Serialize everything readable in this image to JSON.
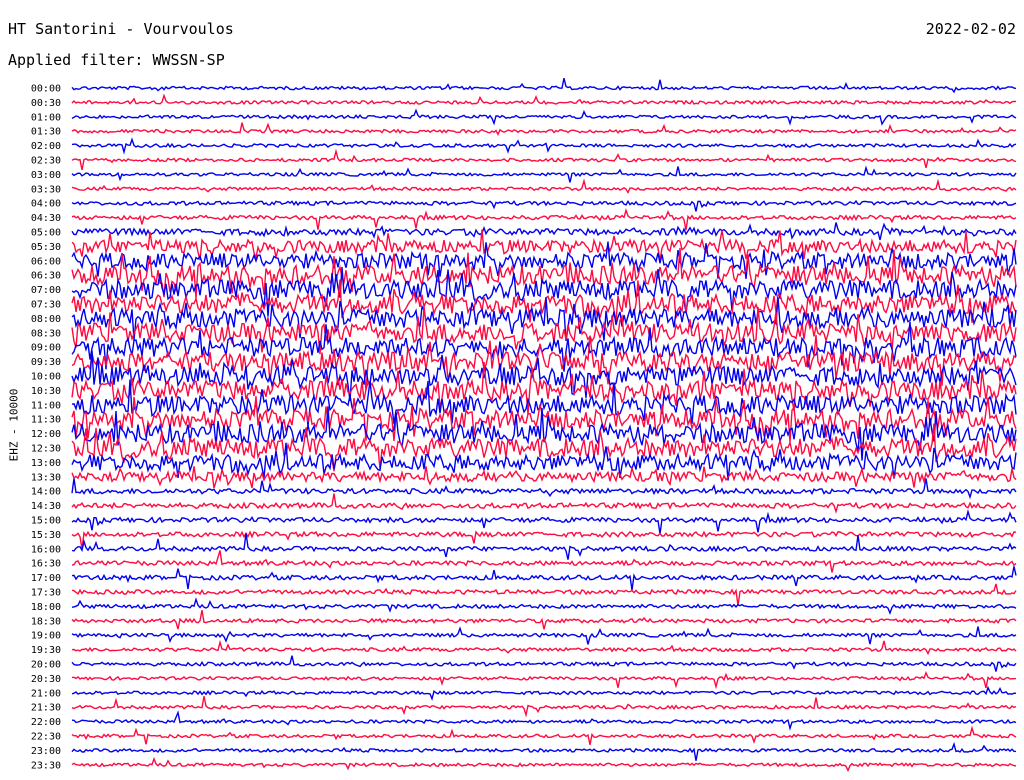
{
  "header": {
    "station": "HT Santorini - Vourvoulos",
    "date": "2022-02-02",
    "filter": "Applied filter: WWSSN-SP",
    "channel": "EHZ - 10000"
  },
  "colors": {
    "even_trace": "#0000ee",
    "odd_trace": "#ff0a40"
  },
  "chart_data": {
    "type": "line",
    "title": "HT Santorini - Vourvoulos",
    "ylabel": "EHZ - 10000",
    "x_range_minutes": [
      0,
      30
    ],
    "categories": [
      "00:00",
      "00:30",
      "01:00",
      "01:30",
      "02:00",
      "02:30",
      "03:00",
      "03:30",
      "04:00",
      "04:30",
      "05:00",
      "05:30",
      "06:00",
      "06:30",
      "07:00",
      "07:30",
      "08:00",
      "08:30",
      "09:00",
      "09:30",
      "10:00",
      "10:30",
      "11:00",
      "11:30",
      "12:00",
      "12:30",
      "13:00",
      "13:30",
      "14:00",
      "14:30",
      "15:00",
      "15:30",
      "16:00",
      "16:30",
      "17:00",
      "17:30",
      "18:00",
      "18:30",
      "19:00",
      "19:30",
      "20:00",
      "20:30",
      "21:00",
      "21:30",
      "22:00",
      "22:30",
      "23:00",
      "23:30"
    ],
    "relative_amplitude": [
      1,
      1,
      1,
      1,
      1,
      1,
      1,
      1,
      1.2,
      1.3,
      2,
      4,
      5,
      6,
      6,
      6,
      6,
      6,
      6,
      6,
      6,
      6,
      6,
      6,
      6,
      6,
      5,
      3,
      1.6,
      1.6,
      1.5,
      1.5,
      1.4,
      1.4,
      1.4,
      1.3,
      1.2,
      1.2,
      1.1,
      1.1,
      1.1,
      1,
      1,
      1,
      1,
      1,
      1,
      1
    ]
  }
}
